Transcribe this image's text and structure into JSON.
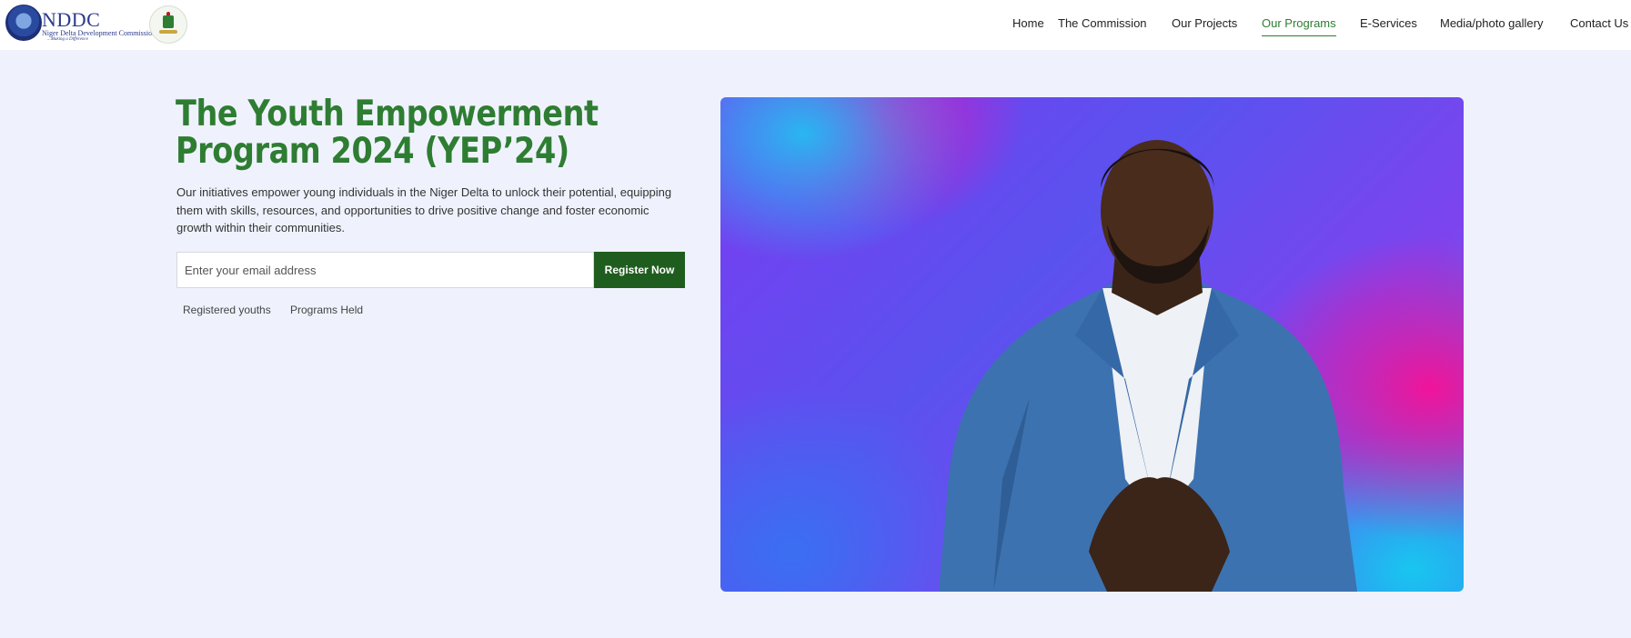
{
  "brand": {
    "name": "NDDC",
    "subtitle": "Niger Delta Development Commission",
    "tagline": "...Making a Difference"
  },
  "nav": {
    "items": [
      {
        "label": "Home",
        "active": false
      },
      {
        "label": "The Commission",
        "active": false
      },
      {
        "label": "Our Projects",
        "active": false
      },
      {
        "label": "Our Programs",
        "active": true
      },
      {
        "label": "E-Services",
        "active": false
      },
      {
        "label": "Media/photo gallery",
        "active": false
      },
      {
        "label": "Contact Us",
        "active": false
      }
    ]
  },
  "hero": {
    "title": "The Youth Empowerment Program 2024 (YEP’24)",
    "description": "Our initiatives empower young individuals in the Niger Delta to unlock their potential, equipping them with skills, resources, and opportunities to drive positive change and foster economic growth within their communities.",
    "email_placeholder": "Enter your email address",
    "email_value": "",
    "register_label": "Register Now",
    "stats": [
      "Registered youths",
      "Programs Held"
    ]
  },
  "colors": {
    "accent": "#2e7d32",
    "button": "#1f5d1e",
    "background": "#eff2fd"
  }
}
